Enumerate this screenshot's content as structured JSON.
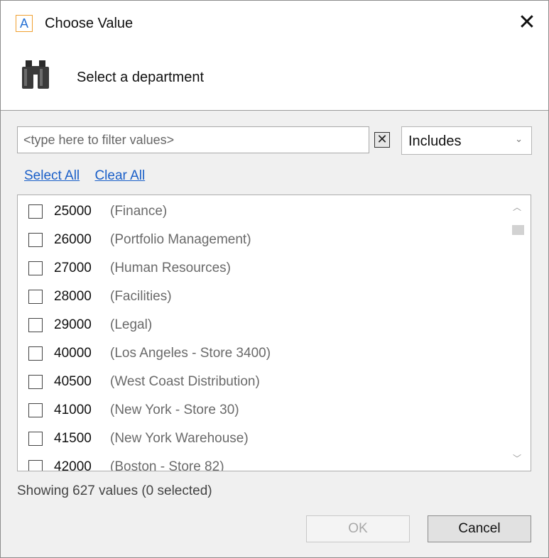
{
  "window": {
    "title": "Choose Value",
    "app_icon_letter": "A",
    "close_glyph": "✕"
  },
  "header": {
    "icon": "binoculars-icon",
    "prompt": "Select a department"
  },
  "filter": {
    "placeholder": "<type here to filter values>",
    "value": "",
    "clear_glyph": "✕",
    "mode": "Includes",
    "mode_chevron": "⌄"
  },
  "links": {
    "select_all": "Select All",
    "clear_all": "Clear All"
  },
  "list": {
    "items": [
      {
        "code": "25000",
        "desc": "(Finance)",
        "checked": false
      },
      {
        "code": "26000",
        "desc": "(Portfolio Management)",
        "checked": false
      },
      {
        "code": "27000",
        "desc": "(Human Resources)",
        "checked": false
      },
      {
        "code": "28000",
        "desc": "(Facilities)",
        "checked": false
      },
      {
        "code": "29000",
        "desc": "(Legal)",
        "checked": false
      },
      {
        "code": "40000",
        "desc": "(Los Angeles - Store 3400)",
        "checked": false
      },
      {
        "code": "40500",
        "desc": "(West Coast Distribution)",
        "checked": false
      },
      {
        "code": "41000",
        "desc": "(New York - Store 30)",
        "checked": false
      },
      {
        "code": "41500",
        "desc": "(New York Warehouse)",
        "checked": false
      },
      {
        "code": "42000",
        "desc": "(Boston - Store 82)",
        "checked": false
      }
    ],
    "scroll_up_glyph": "︿",
    "scroll_down_glyph": "﹀"
  },
  "status": "Showing 627 values (0 selected)",
  "buttons": {
    "ok": "OK",
    "cancel": "Cancel"
  },
  "colors": {
    "link": "#1a5fc8",
    "accent_icon": "#2470d4",
    "icon_border": "#f0a030"
  }
}
